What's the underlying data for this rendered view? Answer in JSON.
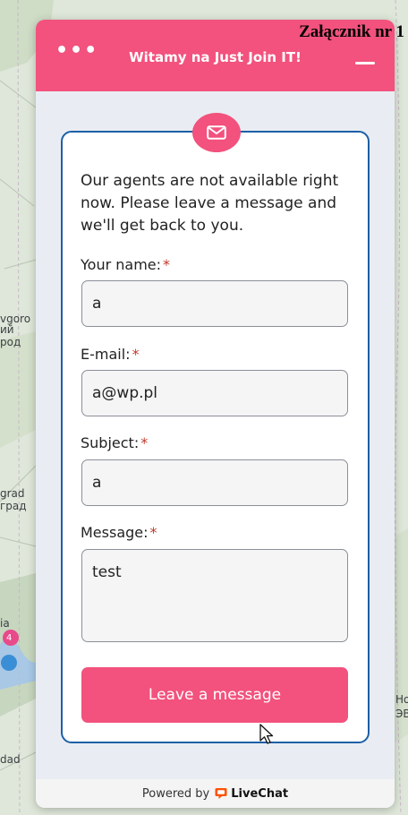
{
  "map": {
    "labels": [
      "vgoro",
      "ий",
      "род",
      "grad",
      "град",
      "ia",
      "Но",
      "ЭВ",
      "dad",
      "4"
    ]
  },
  "annex_label": "Załącznik nr 1",
  "header": {
    "title": "Witamy na Just Join IT!",
    "menu_glyph": "•••"
  },
  "form": {
    "intro": "Our agents are not available right now. Please leave a message and we'll get back to you.",
    "required_mark": "*",
    "fields": [
      {
        "label": "Your name:",
        "value": "a"
      },
      {
        "label": "E-mail:",
        "value": "a@wp.pl"
      },
      {
        "label": "Subject:",
        "value": "a"
      },
      {
        "label": "Message:",
        "value": "test"
      }
    ],
    "submit_label": "Leave a message"
  },
  "footer": {
    "powered_by": "Powered by",
    "brand": "LiveChat"
  },
  "colors": {
    "accent": "#f2527d",
    "card_border": "#1d5fa6",
    "required": "#c0392b"
  }
}
